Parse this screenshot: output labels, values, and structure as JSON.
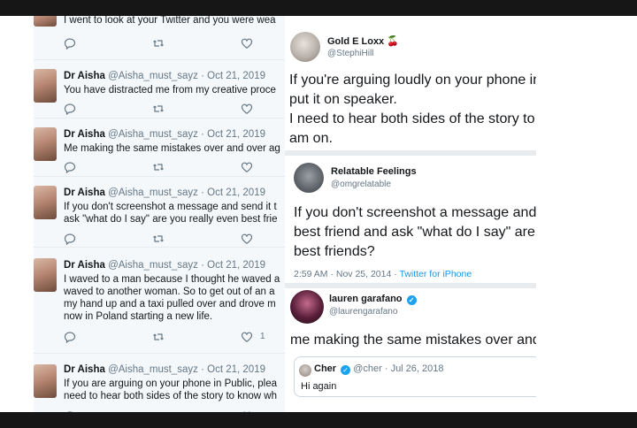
{
  "left_column": {
    "tweets": [
      {
        "name": "",
        "handle": "",
        "date": "",
        "lines": [
          "I went to look at your Twitter and you were wea"
        ],
        "like_count": ""
      },
      {
        "name": "Dr Aisha",
        "handle": "@Aisha_must_sayz",
        "date": "Oct 21, 2019",
        "lines": [
          "You have distracted me from my creative proce"
        ],
        "like_count": ""
      },
      {
        "name": "Dr Aisha",
        "handle": "@Aisha_must_sayz",
        "date": "Oct 21, 2019",
        "lines": [
          "Me making the same mistakes over and over ag"
        ],
        "like_count": ""
      },
      {
        "name": "Dr Aisha",
        "handle": "@Aisha_must_sayz",
        "date": "Oct 21, 2019",
        "lines": [
          "If you don't screenshot a message and send it t",
          "ask \"what do I say\"  are you really even best frie"
        ],
        "like_count": ""
      },
      {
        "name": "Dr Aisha",
        "handle": "@Aisha_must_sayz",
        "date": "Oct 21, 2019",
        "lines": [
          "I waved to a man because I thought he waved a",
          "waved to another woman. So to get out of an a",
          "my hand up and a taxi pulled over and drove m",
          "now in Poland starting a new life."
        ],
        "like_count": "1"
      },
      {
        "name": "Dr Aisha",
        "handle": "@Aisha_must_sayz",
        "date": "Oct 21, 2019",
        "lines": [
          "If you are arguing on your phone in Public, plea",
          "need to hear both sides of the story to know wh"
        ],
        "like_count": ""
      }
    ]
  },
  "right_column": {
    "tweet1": {
      "name": "Gold E Loxx 🍒",
      "handle": "@StephiHill",
      "lines": [
        "If you're arguing loudly on your phone in",
        "put it on speaker.",
        "I need to hear both sides of the story to k",
        "am on."
      ]
    },
    "tweet2": {
      "name": "Relatable Feelings",
      "handle": "@omgrelatable",
      "lines": [
        "If you don't screenshot a message and",
        "best friend and ask \"what do I say\" are",
        "best friends?"
      ],
      "time": "2:59 AM · Nov 25, 2014 · ",
      "source": "Twitter for iPhone"
    },
    "tweet3": {
      "name": "lauren garafano",
      "handle": "@laurengarafano",
      "lines": [
        "me making the same mistakes over and"
      ],
      "quote": {
        "name": "Cher",
        "handle": "@cher",
        "date": "Jul 26, 2018",
        "text": "Hi again"
      }
    }
  },
  "colors": {
    "accent": "#1da1f2",
    "text": "#14171a",
    "muted": "#657786"
  }
}
